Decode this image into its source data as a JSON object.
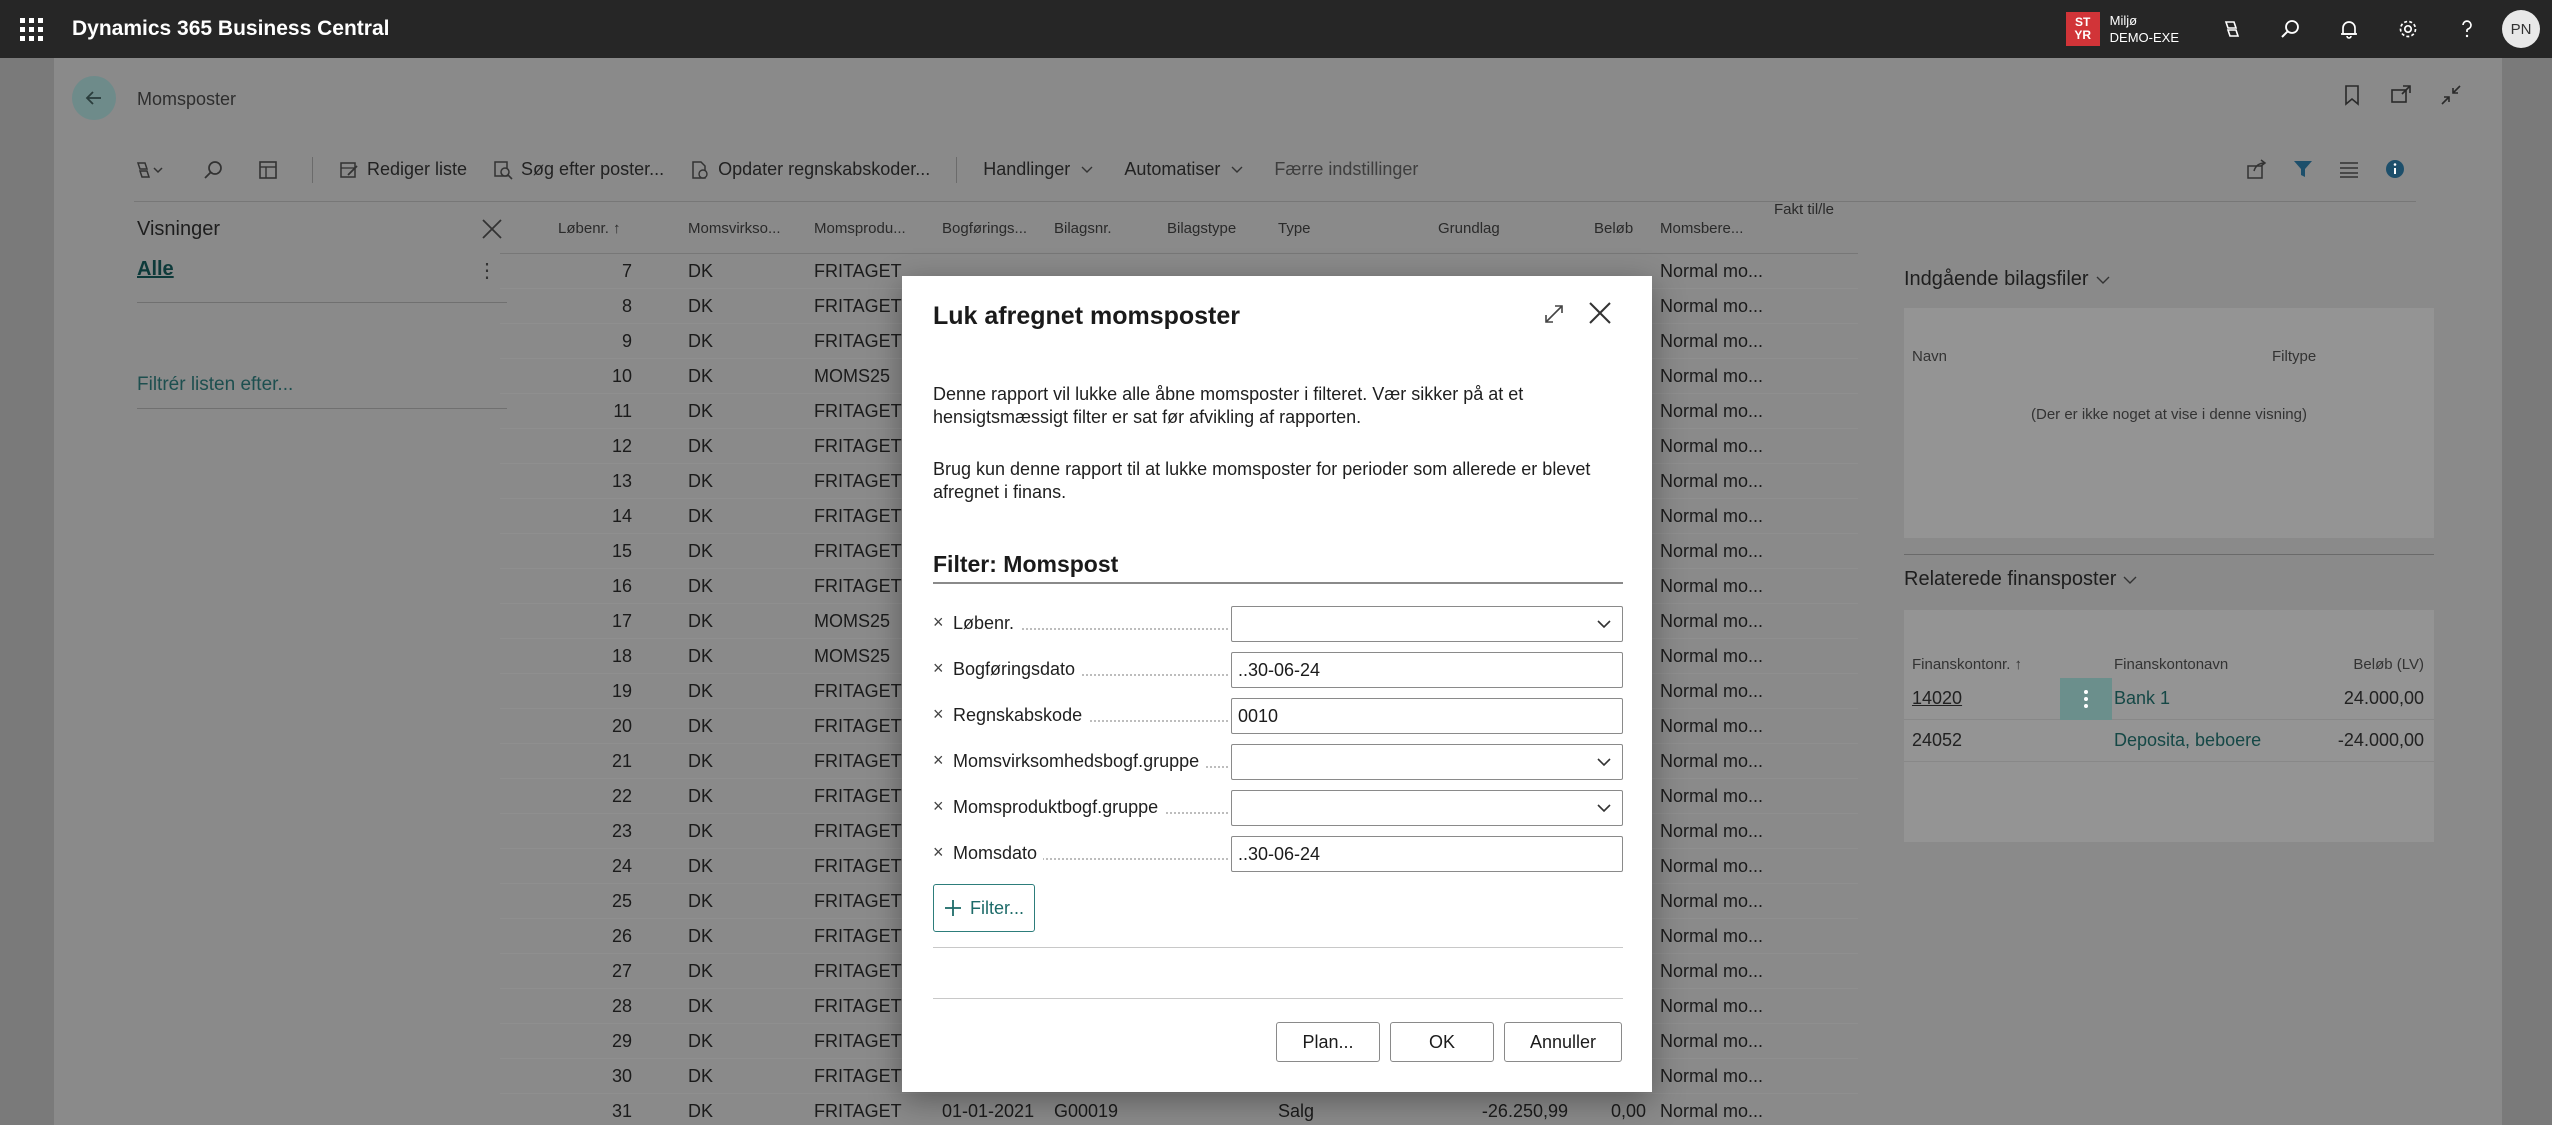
{
  "appbar": {
    "title": "Dynamics 365 Business Central",
    "env_badge_line1": "ST",
    "env_badge_line2": "YR",
    "env_label": "Miljø",
    "env_name": "DEMO-EXE",
    "user_initials": "PN",
    "icons": [
      "waffle-icon",
      "copilot-icon",
      "search-icon",
      "bell-icon",
      "gear-icon",
      "help-icon"
    ]
  },
  "page": {
    "breadcrumb": "Momsposter",
    "actions": {
      "edit_list": "Rediger liste",
      "find_entries": "Søg efter poster...",
      "update_codes": "Opdater regnskabskoder...",
      "actions_menu": "Handlinger",
      "automate_menu": "Automatiser",
      "fewer_options": "Færre indstillinger"
    }
  },
  "views": {
    "title": "Visninger",
    "all": "Alle",
    "filter_list": "Filtrér listen efter..."
  },
  "table": {
    "columns": [
      "Løbenr. ↑",
      "Momsvirkso...",
      "Momsprodu...",
      "Bogførings...",
      "Bilagsnr.",
      "Bilagstype",
      "Type",
      "Grundlag",
      "Beløb",
      "Momsbere...",
      "Fakt til/le"
    ],
    "rows": [
      {
        "no": "7",
        "bus": "DK",
        "prod": "FRITAGET",
        "method": "Normal mo..."
      },
      {
        "no": "8",
        "bus": "DK",
        "prod": "FRITAGET",
        "method": "Normal mo..."
      },
      {
        "no": "9",
        "bus": "DK",
        "prod": "FRITAGET",
        "method": "Normal mo..."
      },
      {
        "no": "10",
        "bus": "DK",
        "prod": "MOMS25",
        "method": "Normal mo..."
      },
      {
        "no": "11",
        "bus": "DK",
        "prod": "FRITAGET",
        "method": "Normal mo..."
      },
      {
        "no": "12",
        "bus": "DK",
        "prod": "FRITAGET",
        "method": "Normal mo..."
      },
      {
        "no": "13",
        "bus": "DK",
        "prod": "FRITAGET",
        "method": "Normal mo..."
      },
      {
        "no": "14",
        "bus": "DK",
        "prod": "FRITAGET",
        "method": "Normal mo..."
      },
      {
        "no": "15",
        "bus": "DK",
        "prod": "FRITAGET",
        "method": "Normal mo..."
      },
      {
        "no": "16",
        "bus": "DK",
        "prod": "FRITAGET",
        "method": "Normal mo..."
      },
      {
        "no": "17",
        "bus": "DK",
        "prod": "MOMS25",
        "method": "Normal mo..."
      },
      {
        "no": "18",
        "bus": "DK",
        "prod": "MOMS25",
        "method": "Normal mo..."
      },
      {
        "no": "19",
        "bus": "DK",
        "prod": "FRITAGET",
        "method": "Normal mo..."
      },
      {
        "no": "20",
        "bus": "DK",
        "prod": "FRITAGET",
        "method": "Normal mo..."
      },
      {
        "no": "21",
        "bus": "DK",
        "prod": "FRITAGET",
        "method": "Normal mo..."
      },
      {
        "no": "22",
        "bus": "DK",
        "prod": "FRITAGET",
        "method": "Normal mo..."
      },
      {
        "no": "23",
        "bus": "DK",
        "prod": "FRITAGET",
        "method": "Normal mo..."
      },
      {
        "no": "24",
        "bus": "DK",
        "prod": "FRITAGET",
        "method": "Normal mo..."
      },
      {
        "no": "25",
        "bus": "DK",
        "prod": "FRITAGET",
        "method": "Normal mo..."
      },
      {
        "no": "26",
        "bus": "DK",
        "prod": "FRITAGET",
        "method": "Normal mo..."
      },
      {
        "no": "27",
        "bus": "DK",
        "prod": "FRITAGET",
        "method": "Normal mo..."
      },
      {
        "no": "28",
        "bus": "DK",
        "prod": "FRITAGET",
        "method": "Normal mo..."
      },
      {
        "no": "29",
        "bus": "DK",
        "prod": "FRITAGET",
        "method": "Normal mo..."
      },
      {
        "no": "30",
        "bus": "DK",
        "prod": "FRITAGET",
        "method": "Normal mo..."
      }
    ],
    "partial_row": {
      "no": "31",
      "bus": "DK",
      "prod": "FRITAGET",
      "date": "01-01-2021",
      "doc": "G00019",
      "type": "Salg",
      "base": "-26.250,99",
      "amount": "0,00",
      "method": "Normal mo..."
    }
  },
  "factbox": {
    "incoming_docs_title": "Indgående bilagsfiler",
    "col_name": "Navn",
    "col_filetype": "Filtype",
    "empty_text": "(Der er ikke noget at vise i denne visning)",
    "related_title": "Relaterede finansposter",
    "related_cols": [
      "Finanskontonr. ↑",
      "Finanskontonavn",
      "Beløb (LV)"
    ],
    "related_rows": [
      {
        "account": "14020",
        "name": "Bank 1",
        "amount": "24.000,00"
      },
      {
        "account": "24052",
        "name": "Deposita, beboere",
        "amount": "-24.000,00"
      }
    ]
  },
  "modal": {
    "title": "Luk afregnet momsposter",
    "para1": "Denne rapport vil lukke alle åbne momsposter i filteret. Vær sikker på at et hensigtsmæssigt filter er sat før afvikling af rapporten.",
    "para2": "Brug kun denne rapport til at lukke momsposter for perioder som allerede er blevet afregnet i finans.",
    "filter_heading": "Filter: Momspost",
    "filters": [
      {
        "label": "Løbenr.",
        "value": ""
      },
      {
        "label": "Bogføringsdato",
        "value": "..30-06-24"
      },
      {
        "label": "Regnskabskode",
        "value": "0010"
      },
      {
        "label": "Momsvirksomhedsbogf.gruppe",
        "value": ""
      },
      {
        "label": "Momsproduktbogf.gruppe",
        "value": ""
      },
      {
        "label": "Momsdato",
        "value": "..30-06-24"
      }
    ],
    "add_filter": "Filter...",
    "buttons": {
      "schedule": "Plan...",
      "ok": "OK",
      "cancel": "Annuller"
    }
  },
  "colors": {
    "accent": "#1d6b69",
    "appbar": "#262626",
    "badge": "#d13438"
  }
}
